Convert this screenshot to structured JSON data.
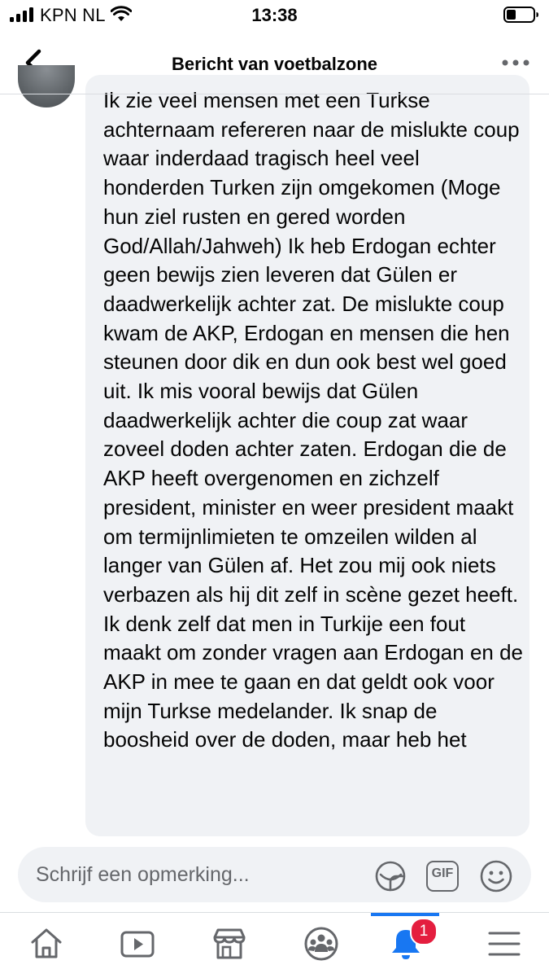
{
  "status_bar": {
    "carrier": "KPN NL",
    "time": "13:38"
  },
  "header": {
    "title": "Bericht van voetbalzone"
  },
  "comment": {
    "text": "Ik zie veel mensen met een Turkse achternaam refereren naar de mislukte coup waar inderdaad tragisch heel veel honderden Turken zijn omgekomen (Moge hun ziel rusten en gered worden God/Allah/Jahweh) Ik heb Erdogan echter geen bewijs zien leveren dat Gülen er daadwerkelijk achter zat. De mislukte coup kwam de AKP, Erdogan en mensen die hen steunen door dik en dun ook best wel goed uit. Ik mis vooral bewijs dat Gülen daadwerkelijk achter die coup zat waar zoveel doden achter zaten. Erdogan die de AKP heeft overgenomen en zichzelf president, minister en weer president maakt om termijnlimieten te omzeilen wilden al langer van Gülen af. Het zou mij ook niets verbazen als hij dit zelf in scène gezet heeft. Ik denk zelf dat men in Turkije een fout maakt om zonder vragen aan Erdogan en de AKP in mee te gaan en dat geldt ook voor mijn Turkse medelander. Ik snap de boosheid over de doden, maar heb het"
  },
  "composer": {
    "placeholder": "Schrijf een opmerking...",
    "gif_label": "GIF"
  },
  "bottom_nav": {
    "notifications_badge": "1",
    "active_tab": "notifications"
  },
  "colors": {
    "accent": "#1877f2",
    "badge": "#e41e3f",
    "bubble": "#f0f2f5",
    "icon": "#65676b"
  }
}
